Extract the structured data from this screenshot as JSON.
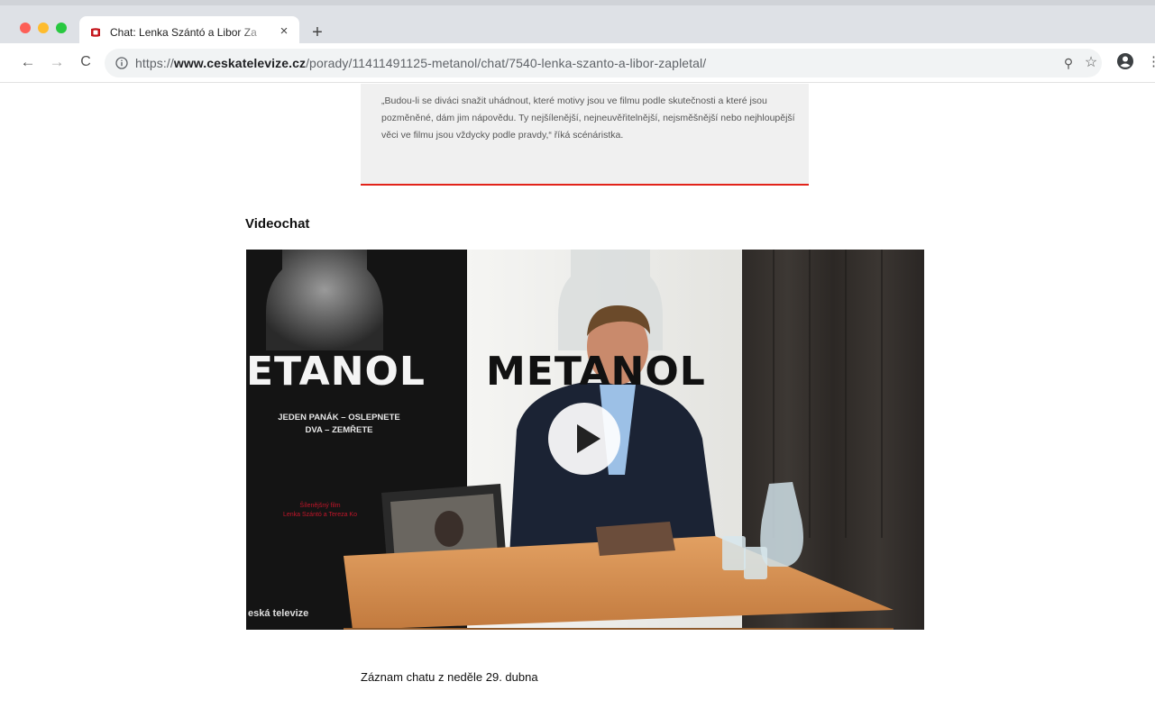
{
  "browser": {
    "tab": {
      "title": "Chat: Lenka Szántó a Libor Za",
      "favicon": "ceska-televize-logo",
      "close_icon": "close-icon"
    },
    "new_tab_label": "+",
    "nav": {
      "back": "←",
      "forward": "→",
      "reload": "C"
    },
    "address": {
      "prefix": "https://",
      "domain": "www.ceskatelevize.cz",
      "path": "/porady/11411491125-metanol/chat/7540-lenka-szanto-a-libor-zapletal/"
    },
    "icons": {
      "zoom": "⚲",
      "bookmark": "☆",
      "profile": "account-circle-icon",
      "menu": "⋮"
    }
  },
  "quote": {
    "text": "„Budou-li se diváci snažit uhádnout, které motivy jsou ve filmu podle skutečnosti a které jsou pozměněné, dám jim nápovědu. Ty nejšílenější, nejneuvěřitelnější, nejsměšnější nebo nejhloupější věci ve filmu jsou vždycky podle pravdy,“ říká scénáristka."
  },
  "videochat": {
    "title": "Videochat",
    "video": {
      "banner_left_title": "ETANOL",
      "banner_right_title": "METANOL",
      "tagline_line1": "JEDEN PANÁK – OSLEPNETE",
      "tagline_line2": "DVA – ZEMŘETE",
      "credits_line1": "Šílenějšný film",
      "credits_line2": "Lenka Szántó a Tereza Ko",
      "watermark": "eská televize"
    },
    "caption": "Záznam chatu z neděle 29. dubna"
  },
  "colors": {
    "accent_red": "#e2231a",
    "quote_bg": "#f0f0f0",
    "chrome_bg": "#dee1e6"
  }
}
